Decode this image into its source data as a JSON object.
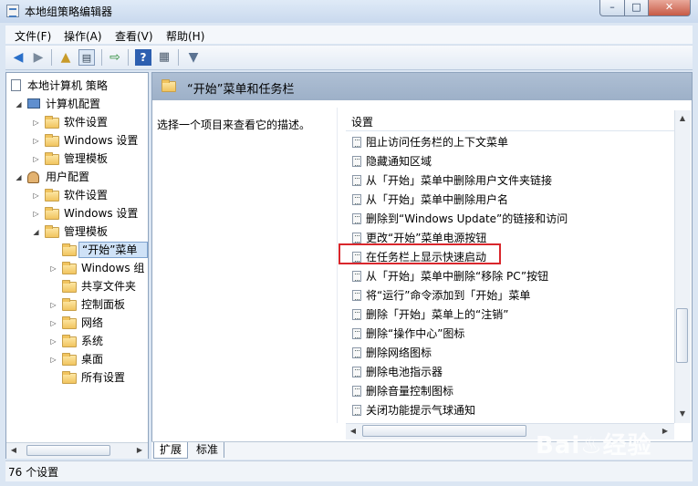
{
  "window": {
    "title": "本地组策略编辑器",
    "min": "–",
    "max": "□",
    "close": "✕"
  },
  "menu": [
    "文件(F)",
    "操作(A)",
    "查看(V)",
    "帮助(H)"
  ],
  "tree": {
    "root": "本地计算机 策略",
    "computer": "计算机配置",
    "c_software": "软件设置",
    "c_windows": "Windows 设置",
    "c_admin": "管理模板",
    "user": "用户配置",
    "u_software": "软件设置",
    "u_windows": "Windows 设置",
    "u_admin": "管理模板",
    "start": "“开始”菜单",
    "wincomp": "Windows 组",
    "shared": "共享文件夹",
    "control": "控制面板",
    "network": "网络",
    "system": "系统",
    "desktop": "桌面",
    "all": "所有设置"
  },
  "right": {
    "header": "“开始”菜单和任务栏",
    "description": "选择一个项目来查看它的描述。",
    "column": "设置",
    "policies": [
      "阻止访问任务栏的上下文菜单",
      "隐藏通知区域",
      "从「开始」菜单中删除用户文件夹链接",
      "从「开始」菜单中删除用户名",
      "删除到“Windows Update”的链接和访问",
      "更改“开始”菜单电源按钮",
      "在任务栏上显示快速启动",
      "从「开始」菜单中删除“移除 PC”按钮",
      "将“运行”命令添加到「开始」菜单",
      "删除「开始」菜单上的“注销”",
      "删除“操作中心”图标",
      "删除网络图标",
      "删除电池指示器",
      "删除音量控制图标",
      "关闭功能提示气球通知"
    ]
  },
  "tabs": {
    "extended": "扩展",
    "standard": "标准"
  },
  "status": "76 个设置",
  "watermark": "Bai♨经验"
}
